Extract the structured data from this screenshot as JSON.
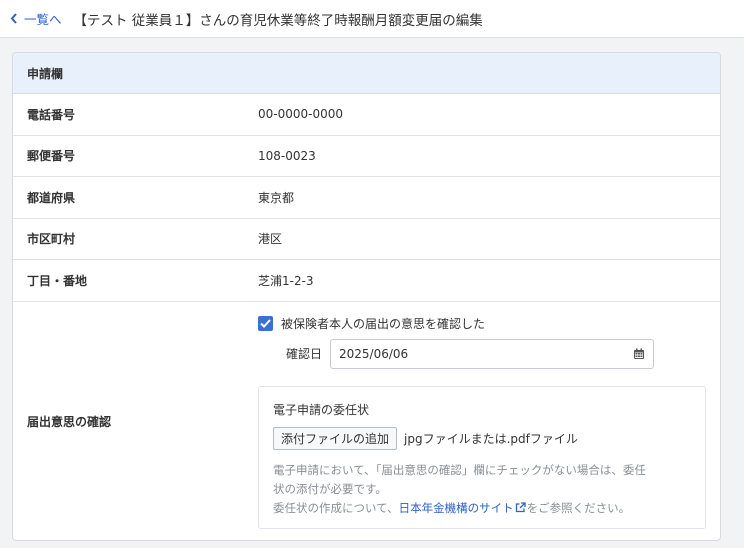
{
  "header": {
    "back_label": "一覧へ",
    "title": "【テスト 従業員１】さんの育児休業等終了時報酬月額変更届の編集"
  },
  "section": {
    "title": "申請欄",
    "rows": [
      {
        "label": "電話番号",
        "value": "00-0000-0000"
      },
      {
        "label": "郵便番号",
        "value": "108-0023"
      },
      {
        "label": "都道府県",
        "value": "東京都"
      },
      {
        "label": "市区町村",
        "value": "港区"
      },
      {
        "label": "丁目・番地",
        "value": "芝浦1-2-3"
      }
    ]
  },
  "consent": {
    "label": "届出意思の確認",
    "checkbox_label": "被保険者本人の届出の意思を確認した",
    "checked": true,
    "date_label": "確認日",
    "date_value": "2025/06/06",
    "attachment": {
      "title": "電子申請の委任状",
      "button_label": "添付ファイルの追加",
      "file_types": "jpgファイルまたは.pdfファイル",
      "note_line1": "電子申請において、「届出意思の確認」欄にチェックがない場合は、委任",
      "note_line2": "状の添付が必要です。",
      "note_line3_prefix": "委任状の作成について、",
      "note_link": "日本年金機構のサイト",
      "note_line3_suffix": "をご参照ください。"
    }
  },
  "icons": [
    "chevron-left-icon",
    "checkmark-icon",
    "calendar-icon",
    "external-link-icon"
  ],
  "colors": {
    "accent": "#3b6fd8",
    "link": "#2f63c6",
    "section_header_bg": "#e8f1fb"
  }
}
